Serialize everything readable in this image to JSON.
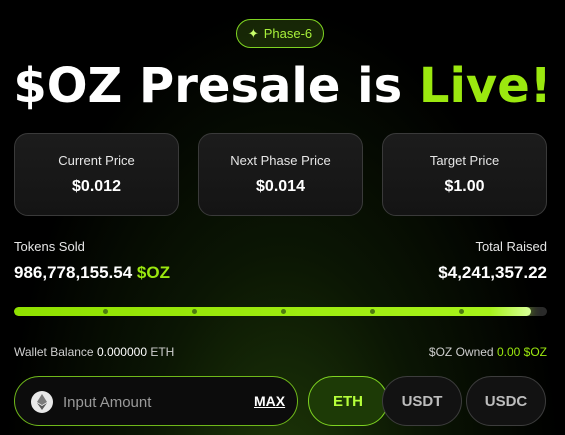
{
  "phase_badge": {
    "icon": "sparkle-icon",
    "label": "Phase-6"
  },
  "headline": {
    "prefix": "$OZ Presale is ",
    "accent": "Live!"
  },
  "price_cards": [
    {
      "label": "Current Price",
      "value": "$0.012"
    },
    {
      "label": "Next Phase Price",
      "value": "$0.014"
    },
    {
      "label": "Target Price",
      "value": "$1.00"
    }
  ],
  "tokens_sold": {
    "label": "Tokens Sold",
    "amount": "986,778,155.54",
    "ticker": "$OZ"
  },
  "total_raised": {
    "label": "Total Raised",
    "amount": "$4,241,357.22"
  },
  "progress": {
    "fraction": 0.97
  },
  "wallet_balance": {
    "label": "Wallet Balance",
    "amount": "0.000000",
    "unit": "ETH"
  },
  "oz_owned": {
    "label": "$OZ Owned",
    "amount": "0.00",
    "unit": "$OZ"
  },
  "amount_input": {
    "placeholder": "Input Amount",
    "value": "",
    "max_label": "MAX",
    "icon": "ethereum-icon"
  },
  "currencies": [
    {
      "label": "ETH",
      "selected": true
    },
    {
      "label": "USDT",
      "selected": false
    },
    {
      "label": "USDC",
      "selected": false
    }
  ],
  "colors": {
    "accent": "#9be80f",
    "background": "#000000",
    "card_border": "#3a3a3a"
  }
}
